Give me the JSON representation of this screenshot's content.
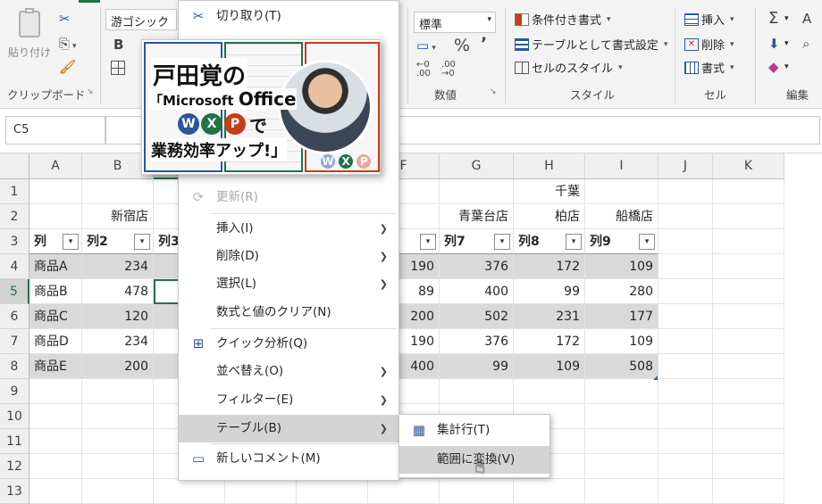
{
  "ribbon": {
    "paste_label": "貼り付け",
    "clipboard_group": "クリップボード",
    "font_name": "游ゴシック",
    "bold": "B",
    "number_format": "標準",
    "percent": "%",
    "comma": "’",
    "number_group": "数値",
    "cond_format": "条件付き書式",
    "format_as_table": "テーブルとして書式設定",
    "cell_styles": "セルのスタイル",
    "style_group": "スタイル",
    "insert": "挿入",
    "delete": "削除",
    "format": "書式",
    "cells_group": "セル",
    "editing_group": "編集",
    "sigma": "Σ"
  },
  "formula_bar": {
    "name_box": "C5"
  },
  "columns": [
    "A",
    "B",
    "C",
    "D",
    "E",
    "F",
    "G",
    "H",
    "I",
    "J",
    "K"
  ],
  "rows": [
    "1",
    "2",
    "3",
    "4",
    "5",
    "6",
    "7",
    "8",
    "9",
    "10",
    "11",
    "12",
    "13"
  ],
  "sheet": {
    "row1": {
      "f": "奈川",
      "h": "千葉"
    },
    "row2": {
      "b": "新宿店",
      "c": "池",
      "f": "浜店",
      "g": "青葉台店",
      "h": "柏店",
      "i": "船橋店"
    },
    "headers": {
      "a": "列",
      "b": "列2",
      "c": "列3",
      "g": "列7",
      "h": "列8",
      "i": "列9"
    },
    "products": [
      "商品A",
      "商品B",
      "商品C",
      "商品D",
      "商品E"
    ],
    "colB": [
      "234",
      "478",
      "120",
      "234",
      "200"
    ],
    "colF": [
      "190",
      "89",
      "200",
      "190",
      "400"
    ],
    "colG": [
      "376",
      "400",
      "502",
      "376",
      "99"
    ],
    "colH": [
      "172",
      "99",
      "231",
      "172",
      "109"
    ],
    "colI": [
      "109",
      "280",
      "177",
      "109",
      "508"
    ]
  },
  "context_menu": {
    "cut": "切り取り(T)",
    "refresh": "更新(R)",
    "insert": "挿入(I)",
    "delete": "削除(D)",
    "select": "選択(L)",
    "clear": "数式と値のクリア(N)",
    "quick": "クイック分析(Q)",
    "sort": "並べ替え(O)",
    "filter": "フィルター(E)",
    "table": "テーブル(B)",
    "comment": "新しいコメント(M)"
  },
  "submenu": {
    "total_row": "集計行(T)",
    "convert": "範囲に変換(V)"
  },
  "promo": {
    "name": "戸田覚の",
    "line2a": "「Microsoft ",
    "line2b": "Office",
    "w": "W",
    "x": "X",
    "p": "P",
    "de": "で",
    "line4": "業務効率アップ!」"
  },
  "colors": {
    "accent": "#217346",
    "band": "#d9d9d9",
    "word": "#2b579a",
    "excel": "#217346",
    "ppt": "#c43e1c"
  }
}
